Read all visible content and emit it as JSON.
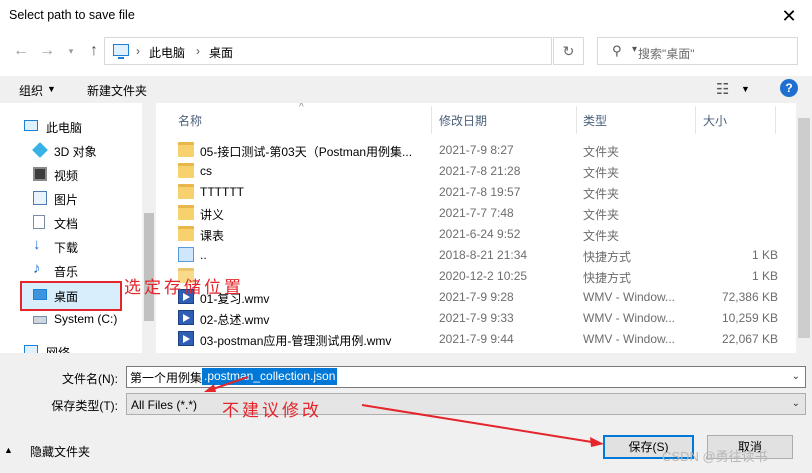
{
  "window": {
    "title": "Select path to save file"
  },
  "nav": {
    "breadcrumb": [
      "此电脑",
      "桌面"
    ],
    "search_placeholder": "搜索\"桌面\""
  },
  "toolbar": {
    "organize": "组织",
    "new_folder": "新建文件夹"
  },
  "sidebar": {
    "items": [
      {
        "label": "此电脑",
        "icon": "computer-icon"
      },
      {
        "label": "3D 对象",
        "icon": "cube-icon"
      },
      {
        "label": "视频",
        "icon": "video-folder-icon"
      },
      {
        "label": "图片",
        "icon": "pictures-icon"
      },
      {
        "label": "文档",
        "icon": "documents-icon"
      },
      {
        "label": "下载",
        "icon": "download-icon"
      },
      {
        "label": "音乐",
        "icon": "music-icon"
      },
      {
        "label": "桌面",
        "icon": "desktop-icon"
      },
      {
        "label": "System (C:)",
        "icon": "drive-icon"
      },
      {
        "label": "网络",
        "icon": "network-icon"
      }
    ]
  },
  "file_list": {
    "columns": {
      "name": "名称",
      "date": "修改日期",
      "type": "类型",
      "size": "大小"
    },
    "rows": [
      {
        "name": "05-接口测试-第03天（Postman用例集...",
        "date": "2021-7-9 8:27",
        "type": "文件夹",
        "size": "",
        "icon": "folder-icon"
      },
      {
        "name": "cs",
        "date": "2021-7-8 21:28",
        "type": "文件夹",
        "size": "",
        "icon": "folder-icon"
      },
      {
        "name": "TTTTTT",
        "date": "2021-7-8 19:57",
        "type": "文件夹",
        "size": "",
        "icon": "folder-icon"
      },
      {
        "name": "讲义",
        "date": "2021-7-7 7:48",
        "type": "文件夹",
        "size": "",
        "icon": "folder-icon"
      },
      {
        "name": "课表",
        "date": "2021-6-24 9:52",
        "type": "文件夹",
        "size": "",
        "icon": "folder-icon"
      },
      {
        "name": "..",
        "date": "2018-8-21 21:34",
        "type": "快捷方式",
        "size": "1 KB",
        "icon": "shortcut-icon"
      },
      {
        "name": "",
        "date": "2020-12-2 10:25",
        "type": "快捷方式",
        "size": "1 KB",
        "icon": "shortcut-icon"
      },
      {
        "name": "01-复习.wmv",
        "date": "2021-7-9 9:28",
        "type": "WMV - Window...",
        "size": "72,386 KB",
        "icon": "video-file-icon"
      },
      {
        "name": "02-总述.wmv",
        "date": "2021-7-9 9:33",
        "type": "WMV - Window...",
        "size": "10,259 KB",
        "icon": "video-file-icon"
      },
      {
        "name": "03-postman应用-管理测试用例.wmv",
        "date": "2021-7-9 9:44",
        "type": "WMV - Window...",
        "size": "22,067 KB",
        "icon": "video-file-icon"
      }
    ]
  },
  "form": {
    "filename_label": "文件名(N):",
    "filename_prefix": "第一个用例集",
    "filename_selected": ".postman_collection.json",
    "filetype_label": "保存类型(T):",
    "filetype_value": "All Files (*.*)",
    "save": "保存(S)",
    "cancel": "取消",
    "hide_folders": "隐藏文件夹"
  },
  "annotations": {
    "select_location": "选定存储位置",
    "not_recommended": "不建议修改",
    "color": "#e4252b"
  },
  "watermark": "CSDN @勇往读书"
}
